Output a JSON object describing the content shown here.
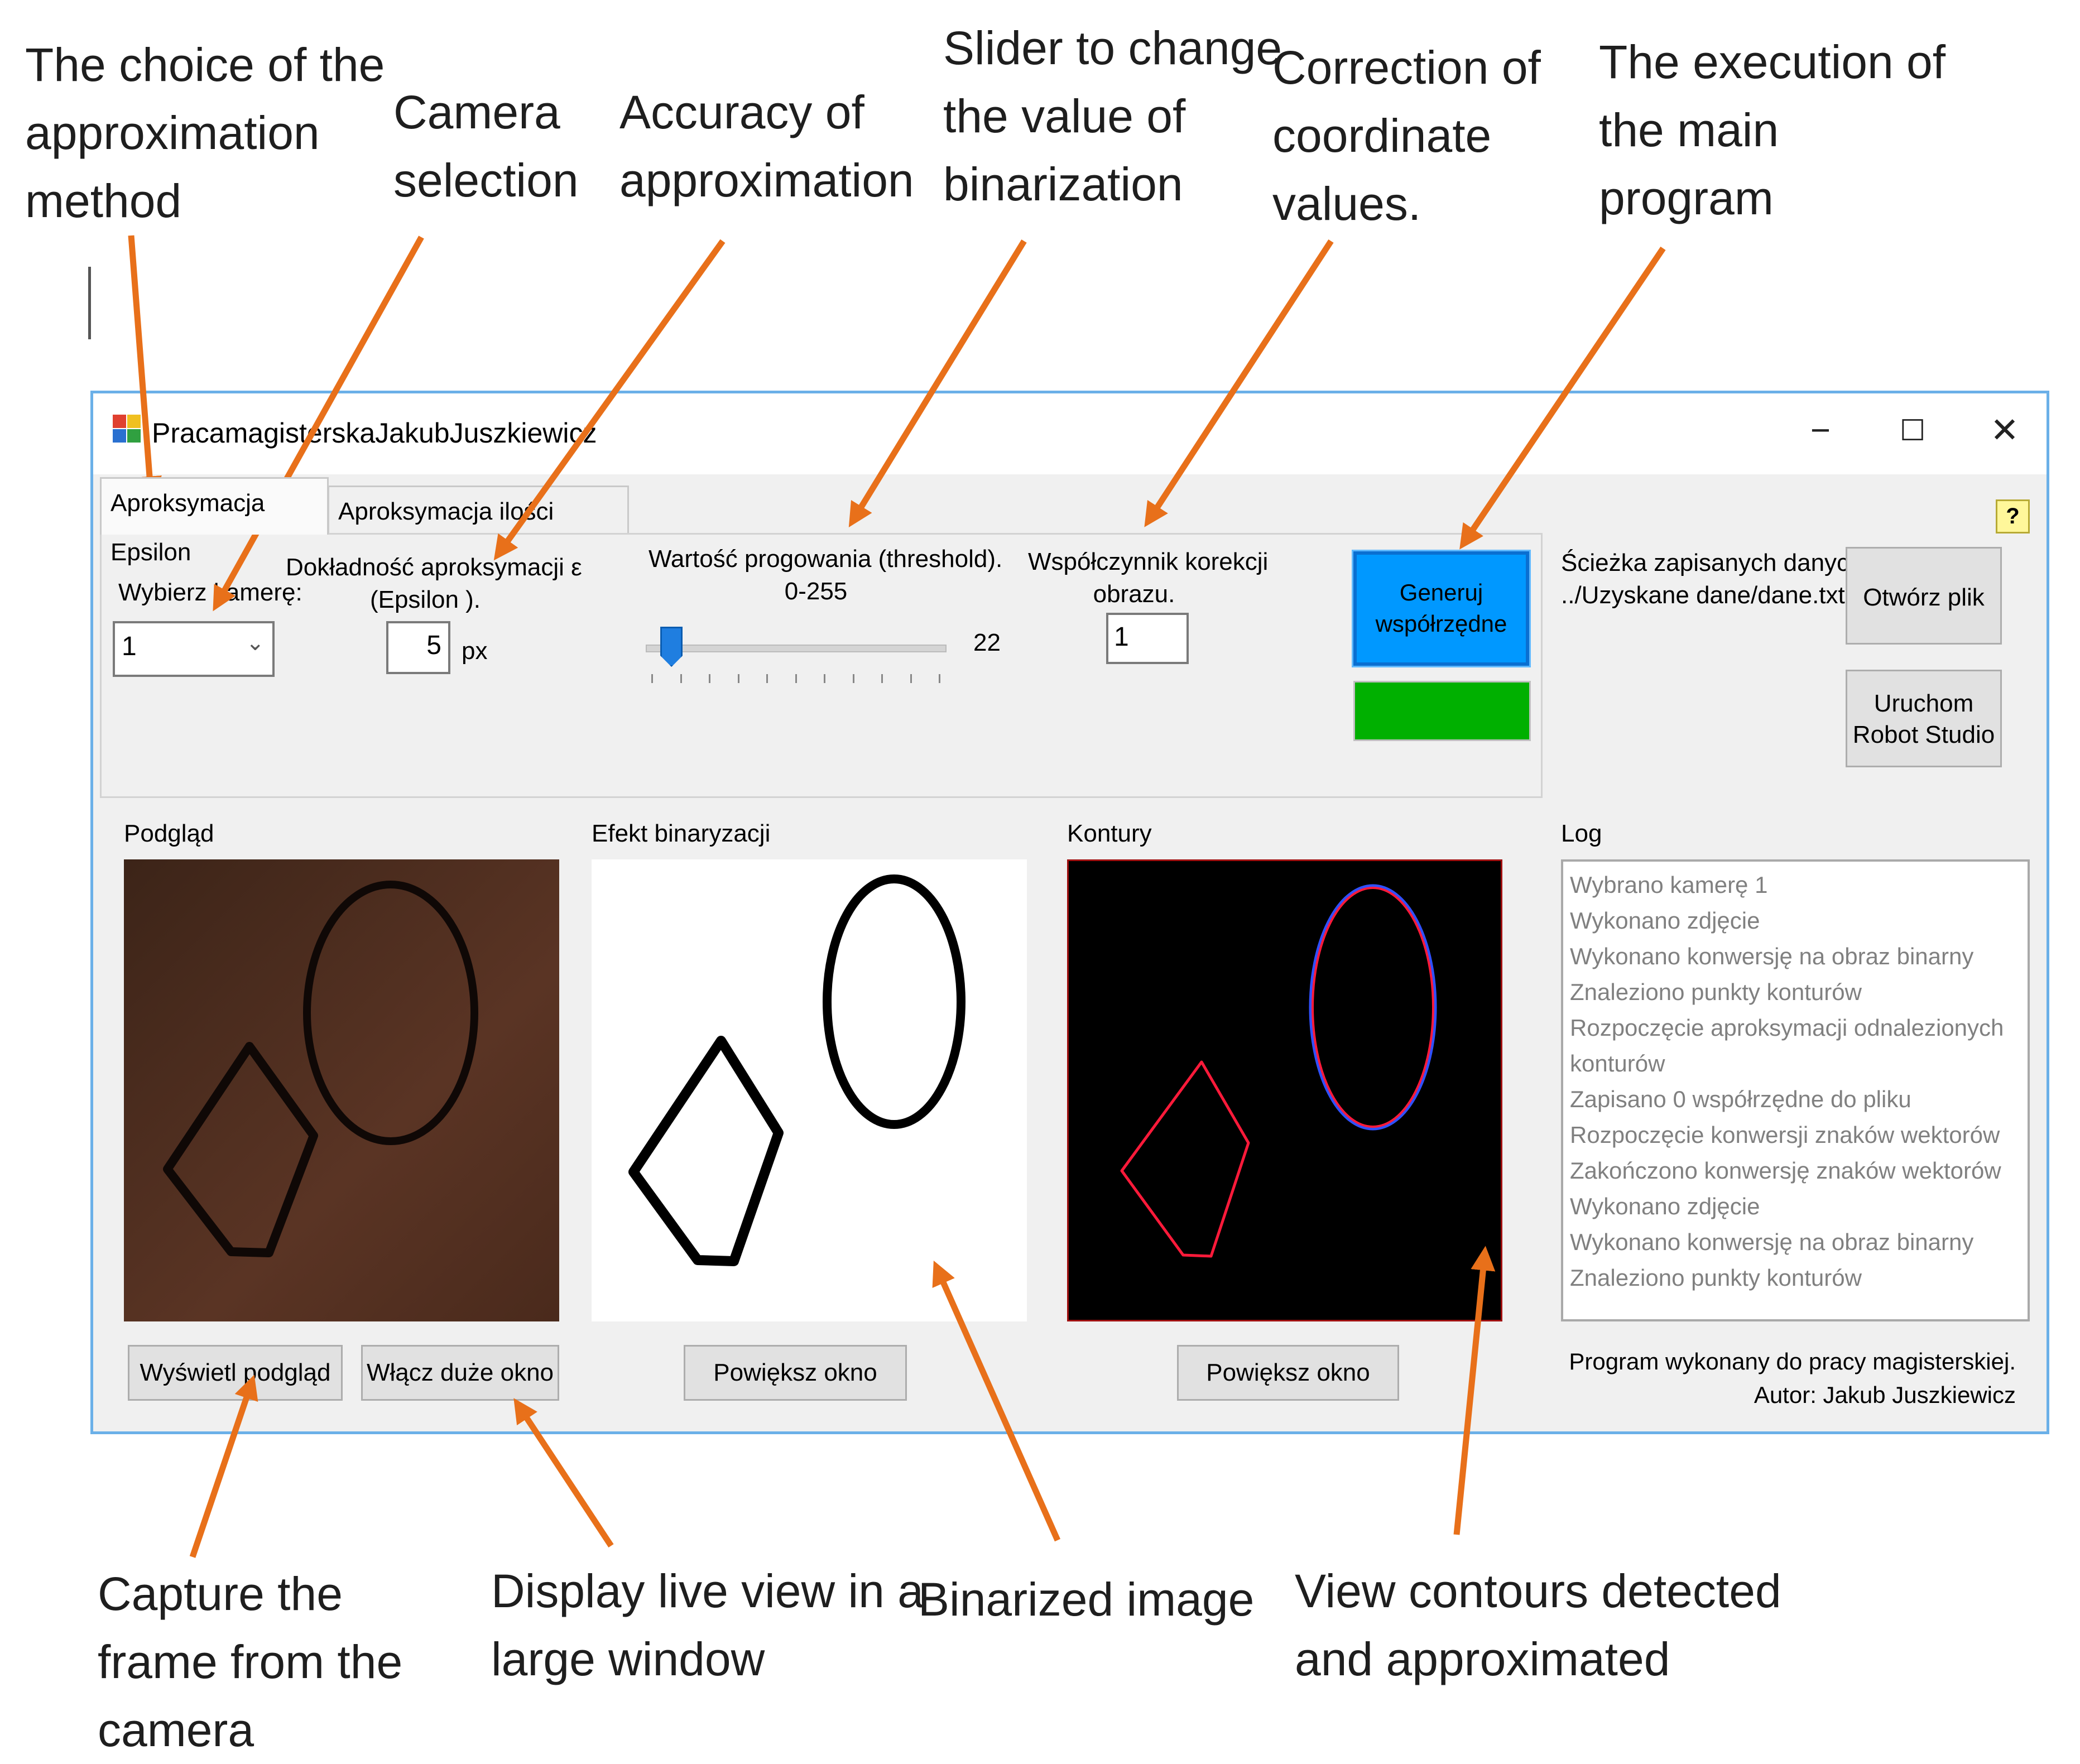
{
  "annotations": {
    "approx_method": [
      "The choice of the",
      "approximation",
      "method"
    ],
    "camera_selection": [
      "Camera",
      "selection"
    ],
    "accuracy": [
      "Accuracy of",
      "approximation"
    ],
    "slider": [
      "Slider to change",
      "the value of",
      "binarization"
    ],
    "correction": [
      "Correction of",
      "coordinate",
      "values."
    ],
    "execution": [
      "The execution of",
      "the main",
      "program"
    ],
    "capture": [
      "Capture the",
      "frame from the",
      "camera"
    ],
    "live_view": [
      "Display live view in a",
      "large window"
    ],
    "binarized": [
      "Binarized image"
    ],
    "contours": [
      "View contours detected",
      "and approximated"
    ]
  },
  "window": {
    "title": "PracamagisterskaJakubJuszkiewicz",
    "minimize": "−",
    "maximize": "☐",
    "close": "✕"
  },
  "tabs": [
    {
      "label": "Aproksymacja Epsilon",
      "active": true
    },
    {
      "label": "Aproksymacja ilości konturów",
      "active": false
    }
  ],
  "help_label": "?",
  "controls": {
    "camera_label": "Wybierz kamerę:",
    "camera_value": "1",
    "epsilon_label_1": "Dokładność aproksymacji ε",
    "epsilon_label_2": "(Epsilon ).",
    "epsilon_value": "5",
    "epsilon_unit": "px",
    "threshold_label_1": "Wartość progowania (threshold).",
    "threshold_label_2": "0-255",
    "threshold_value": "22",
    "threshold_min": 0,
    "threshold_max": 255,
    "correction_label_1": "Współczynnik korekcji",
    "correction_label_2": "obrazu.",
    "correction_value": "1",
    "generate_label_1": "Generuj",
    "generate_label_2": "współrzędne",
    "status_color": "#00b000"
  },
  "file": {
    "path_label": "Ścieżka zapisanych danych:",
    "path_value": "../Uzyskane dane/dane.txt",
    "open_button": "Otwórz plik",
    "robot_button_1": "Uruchom",
    "robot_button_2": "Robot Studio"
  },
  "views": {
    "preview_label": "Podgląd",
    "binary_label": "Efekt binaryzacji",
    "contours_label": "Kontury",
    "log_label": "Log",
    "show_preview_button": "Wyświetl podgląd",
    "large_window_button": "Włącz duże okno",
    "enlarge_button_1": "Powiększ okno",
    "enlarge_button_2": "Powiększ okno"
  },
  "log": [
    "Wybrano kamerę 1",
    "Wykonano zdjęcie",
    "Wykonano konwersję na obraz binarny",
    "Znaleziono punkty konturów",
    "Rozpoczęcie aproksymacji odnalezionych",
    "konturów",
    "Zapisano 0 współrzędne do pliku",
    "Rozpoczęcie konwersji znaków wektorów",
    "Zakończono konwersję znaków wektorów",
    "Wykonano zdjęcie",
    "Wykonano konwersję na obraz binarny",
    "Znaleziono punkty konturów"
  ],
  "footer": {
    "line1": "Program wykonany do pracy magisterskiej.",
    "line2": "Autor: Jakub Juszkiewicz"
  },
  "colors": {
    "arrow": "#e8701a",
    "window_border": "#6bb0e8",
    "generate_button": "#0098ff",
    "preview_bg": "#4a2a1e",
    "contour_red": "#ff1a3a",
    "contour_blue": "#3050ff"
  }
}
